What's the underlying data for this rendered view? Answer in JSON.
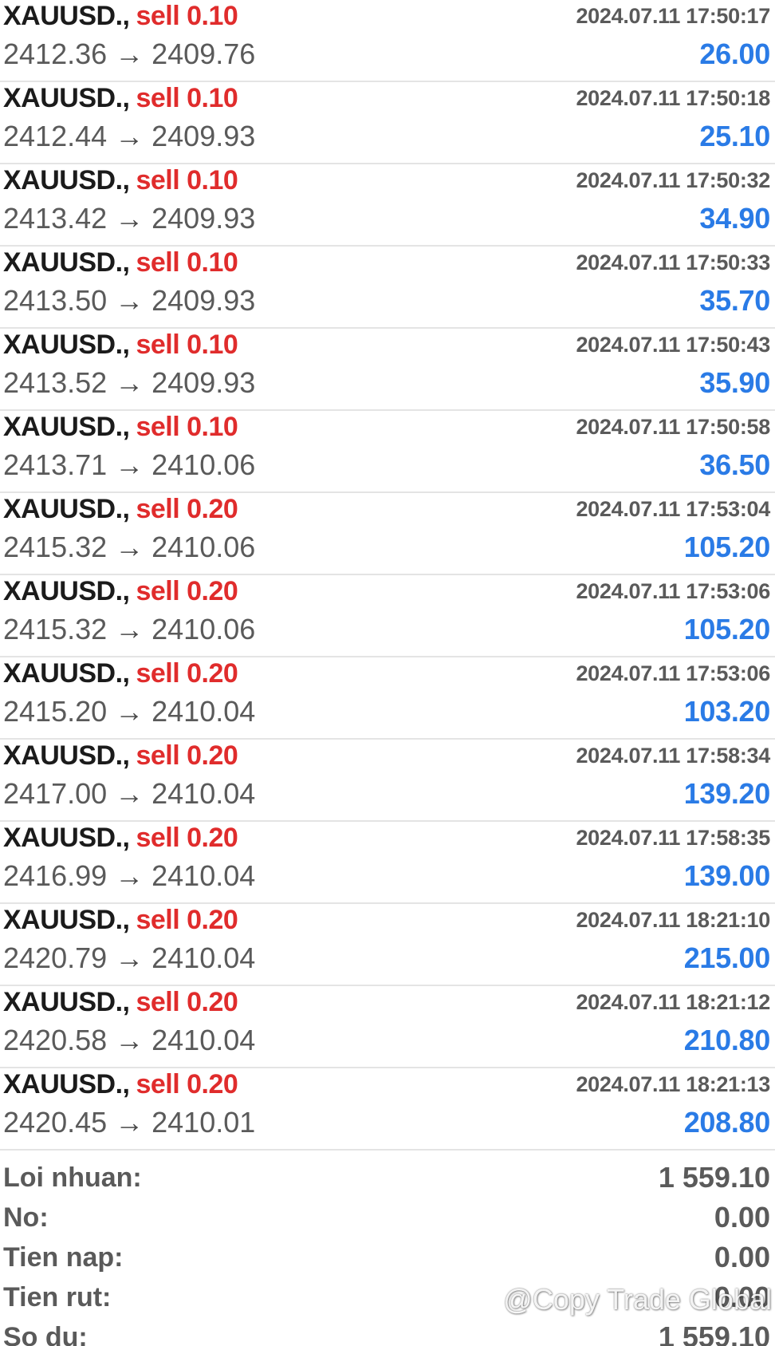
{
  "trades": [
    {
      "symbol": "XAUUSD.,",
      "side": "sell 0.10",
      "time": "2024.07.11 17:50:17",
      "open_price": "2412.36",
      "arrow": "→",
      "close_price": "2409.76",
      "profit": "26.00"
    },
    {
      "symbol": "XAUUSD.,",
      "side": "sell 0.10",
      "time": "2024.07.11 17:50:18",
      "open_price": "2412.44",
      "arrow": "→",
      "close_price": "2409.93",
      "profit": "25.10"
    },
    {
      "symbol": "XAUUSD.,",
      "side": "sell 0.10",
      "time": "2024.07.11 17:50:32",
      "open_price": "2413.42",
      "arrow": "→",
      "close_price": "2409.93",
      "profit": "34.90"
    },
    {
      "symbol": "XAUUSD.,",
      "side": "sell 0.10",
      "time": "2024.07.11 17:50:33",
      "open_price": "2413.50",
      "arrow": "→",
      "close_price": "2409.93",
      "profit": "35.70"
    },
    {
      "symbol": "XAUUSD.,",
      "side": "sell 0.10",
      "time": "2024.07.11 17:50:43",
      "open_price": "2413.52",
      "arrow": "→",
      "close_price": "2409.93",
      "profit": "35.90"
    },
    {
      "symbol": "XAUUSD.,",
      "side": "sell 0.10",
      "time": "2024.07.11 17:50:58",
      "open_price": "2413.71",
      "arrow": "→",
      "close_price": "2410.06",
      "profit": "36.50"
    },
    {
      "symbol": "XAUUSD.,",
      "side": "sell 0.20",
      "time": "2024.07.11 17:53:04",
      "open_price": "2415.32",
      "arrow": "→",
      "close_price": "2410.06",
      "profit": "105.20"
    },
    {
      "symbol": "XAUUSD.,",
      "side": "sell 0.20",
      "time": "2024.07.11 17:53:06",
      "open_price": "2415.32",
      "arrow": "→",
      "close_price": "2410.06",
      "profit": "105.20"
    },
    {
      "symbol": "XAUUSD.,",
      "side": "sell 0.20",
      "time": "2024.07.11 17:53:06",
      "open_price": "2415.20",
      "arrow": "→",
      "close_price": "2410.04",
      "profit": "103.20"
    },
    {
      "symbol": "XAUUSD.,",
      "side": "sell 0.20",
      "time": "2024.07.11 17:58:34",
      "open_price": "2417.00",
      "arrow": "→",
      "close_price": "2410.04",
      "profit": "139.20"
    },
    {
      "symbol": "XAUUSD.,",
      "side": "sell 0.20",
      "time": "2024.07.11 17:58:35",
      "open_price": "2416.99",
      "arrow": "→",
      "close_price": "2410.04",
      "profit": "139.00"
    },
    {
      "symbol": "XAUUSD.,",
      "side": "sell 0.20",
      "time": "2024.07.11 18:21:10",
      "open_price": "2420.79",
      "arrow": "→",
      "close_price": "2410.04",
      "profit": "215.00"
    },
    {
      "symbol": "XAUUSD.,",
      "side": "sell 0.20",
      "time": "2024.07.11 18:21:12",
      "open_price": "2420.58",
      "arrow": "→",
      "close_price": "2410.04",
      "profit": "210.80"
    },
    {
      "symbol": "XAUUSD.,",
      "side": "sell 0.20",
      "time": "2024.07.11 18:21:13",
      "open_price": "2420.45",
      "arrow": "→",
      "close_price": "2410.01",
      "profit": "208.80"
    }
  ],
  "summary": [
    {
      "label": "Loi nhuan:",
      "value": "1 559.10"
    },
    {
      "label": "No:",
      "value": "0.00"
    },
    {
      "label": "Tien nap:",
      "value": "0.00"
    },
    {
      "label": "Tien rut:",
      "value": "0.00"
    },
    {
      "label": "So du:",
      "value": "1 559.10"
    }
  ],
  "watermark": {
    "text": "@Copy Trade Global",
    "icon": "douyin-logo-icon"
  },
  "colors": {
    "sell": "#e02c2c",
    "profit": "#2a7be6",
    "text_dark": "#1b1b1b",
    "text_gray": "#5a5a5a",
    "divider": "#e4e4e4"
  }
}
